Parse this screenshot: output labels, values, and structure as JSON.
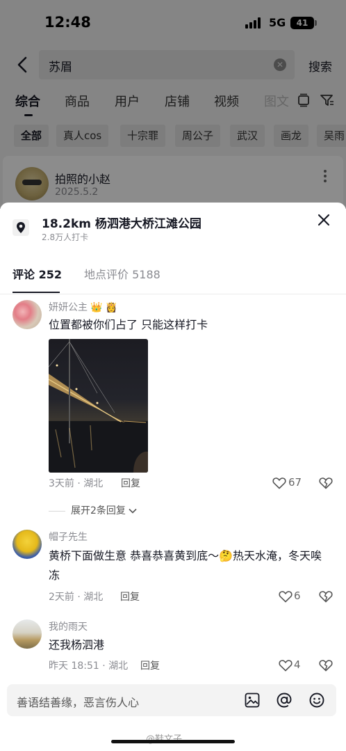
{
  "status": {
    "time": "12:48",
    "network": "5G",
    "battery": "41"
  },
  "search": {
    "query": "苏眉",
    "button": "搜索"
  },
  "category_tabs": [
    "综合",
    "商品",
    "用户",
    "店铺",
    "视频",
    "图文"
  ],
  "chips": [
    "全部",
    "真人cos",
    "十宗罪",
    "周公子",
    "武汉",
    "画龙",
    "吴雨"
  ],
  "card": {
    "author": "拍照的小赵",
    "date": "2025.5.2"
  },
  "location": {
    "title": "18.2km  杨泗港大桥江滩公园",
    "checkins": "2.8万人打卡"
  },
  "sheet_tabs": {
    "comments": "评论 252",
    "reviews": "地点评价 5188"
  },
  "comments": [
    {
      "name": "妍妍公主",
      "crowns": "👑 👸",
      "text": "位置都被你们占了 只能这样打卡",
      "meta": "3天前 · 湖北",
      "reply": "回复",
      "likes": "67",
      "expand": "展开2条回复"
    },
    {
      "name": "帽子先生",
      "text": "黄桥下面做生意 恭喜恭喜黄到底～🤔热天水淹，冬天唉冻",
      "meta": "2天前 · 湖北",
      "reply": "回复",
      "likes": "6"
    },
    {
      "name": "我的雨天",
      "text": "还我杨泗港",
      "meta": "昨天 18:51 · 湖北",
      "reply": "回复",
      "likes": "4"
    }
  ],
  "input": {
    "placeholder": "善语结善缘，恶言伤人心"
  },
  "watermark": "@鞋文子"
}
